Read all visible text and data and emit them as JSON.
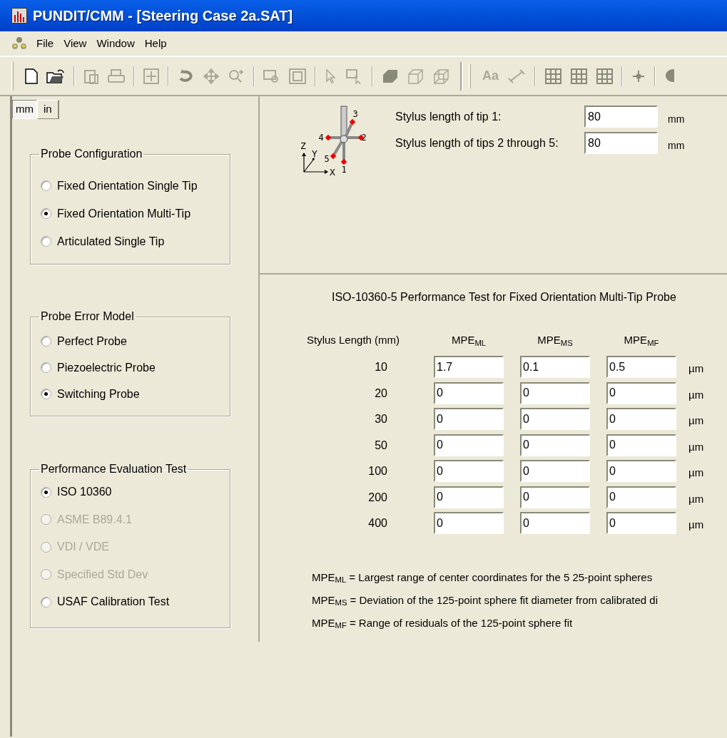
{
  "window": {
    "title": "PUNDIT/CMM - [Steering Case 2a.SAT]"
  },
  "menu": [
    "File",
    "View",
    "Window",
    "Help"
  ],
  "toolbar": {
    "text_button": "Aa"
  },
  "unit_tabs": [
    {
      "label": "mm",
      "selected": true
    },
    {
      "label": "in",
      "selected": false
    }
  ],
  "groups": [
    {
      "title": "Probe Configuration",
      "options": [
        {
          "label": "Fixed Orientation Single Tip",
          "selected": false,
          "disabled": false
        },
        {
          "label": "Fixed Orientation Multi-Tip",
          "selected": true,
          "disabled": false
        },
        {
          "label": "Articulated Single Tip",
          "selected": false,
          "disabled": false
        }
      ]
    },
    {
      "title": "Probe Error Model",
      "options": [
        {
          "label": "Perfect Probe",
          "selected": false,
          "disabled": false
        },
        {
          "label": "Piezoelectric Probe",
          "selected": false,
          "disabled": false
        },
        {
          "label": "Switching Probe",
          "selected": true,
          "disabled": false
        }
      ]
    },
    {
      "title": "Performance Evaluation Test",
      "options": [
        {
          "label": "ISO 10360",
          "selected": true,
          "disabled": false
        },
        {
          "label": "ASME B89.4.1",
          "selected": false,
          "disabled": true
        },
        {
          "label": "VDI / VDE",
          "selected": false,
          "disabled": true
        },
        {
          "label": "Specified Std Dev",
          "selected": false,
          "disabled": true
        },
        {
          "label": "USAF Calibration Test",
          "selected": false,
          "disabled": false
        }
      ]
    }
  ],
  "stylus": {
    "tip_labels": [
      "1",
      "2",
      "3",
      "4",
      "5"
    ],
    "axis_labels": [
      "X",
      "Y",
      "Z"
    ],
    "fields": [
      {
        "label": "Stylus length of tip 1:",
        "value": "80",
        "unit": "mm"
      },
      {
        "label": "Stylus length of tips 2 through 5:",
        "value": "80",
        "unit": "mm"
      }
    ]
  },
  "test": {
    "title": "ISO-10360-5 Performance Test for Fixed Orientation Multi-Tip Probe",
    "columns": [
      "Stylus Length (mm)",
      "MPE$_{ML}$",
      "MPE$_{MS}$",
      "MPE$_{MF}$"
    ],
    "rows": [
      {
        "length": "10",
        "values": [
          "1.7",
          "0.1",
          "0.5"
        ],
        "unit": "µm"
      },
      {
        "length": "20",
        "values": [
          "0",
          "0",
          "0"
        ],
        "unit": "µm"
      },
      {
        "length": "30",
        "values": [
          "0",
          "0",
          "0"
        ],
        "unit": "µm"
      },
      {
        "length": "50",
        "values": [
          "0",
          "0",
          "0"
        ],
        "unit": "µm"
      },
      {
        "length": "100",
        "values": [
          "0",
          "0",
          "0"
        ],
        "unit": "µm"
      },
      {
        "length": "200",
        "values": [
          "0",
          "0",
          "0"
        ],
        "unit": "µm"
      },
      {
        "length": "400",
        "values": [
          "0",
          "0",
          "0"
        ],
        "unit": "µm"
      }
    ],
    "definitions": [
      "MPE$_{ML}$ = Largest range of center coordinates for the 5 25-point spheres",
      "MPE$_{MS}$ = Deviation of the 125-point sphere fit diameter from calibrated di",
      "MPE$_{MF}$ = Range of residuals of the 125-point sphere fit"
    ]
  }
}
